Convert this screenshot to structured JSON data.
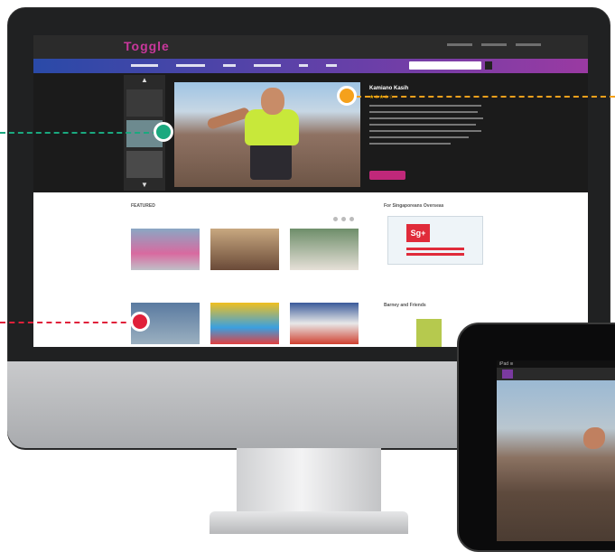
{
  "site": {
    "logo": "Toggle",
    "hero": {
      "title": "Kamiano Kasih",
      "stars": "★★★★☆"
    },
    "featured_heading": "FEATURED",
    "sidebar": {
      "heading_1": "For Singaporeans Overseas",
      "ad_logo": "Sg+",
      "heading_2": "Barney and Friends"
    }
  },
  "ipad": {
    "status": "iPad ≋"
  },
  "callout_colors": {
    "teal": "#1aa97f",
    "orange": "#f5a11c",
    "red": "#e0203a"
  }
}
